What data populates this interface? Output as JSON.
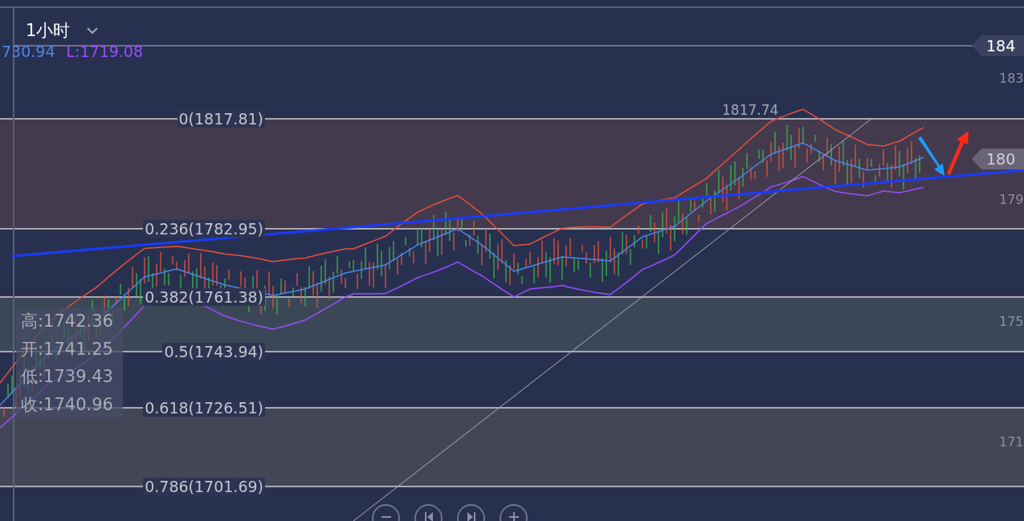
{
  "timeframe": {
    "label": "1小时",
    "expanded": false
  },
  "legend": [
    {
      "text": "730.94",
      "color": "#4a86e8"
    },
    {
      "text": "L:1719.08",
      "color": "#9b4dff"
    }
  ],
  "price_axis": [
    {
      "text": "184",
      "kind": "tag"
    },
    {
      "text": "183",
      "kind": "plain"
    },
    {
      "text": "180",
      "kind": "tag"
    },
    {
      "text": "179",
      "kind": "plain"
    },
    {
      "text": "175",
      "kind": "plain"
    },
    {
      "text": "171",
      "kind": "plain"
    }
  ],
  "fib_levels": [
    {
      "label": "0(1817.81)",
      "color": "#433a4e"
    },
    {
      "label": "0.236(1782.95)"
    },
    {
      "label": "0.382(1761.38)",
      "color": "#3b4756"
    },
    {
      "label": "0.5(1743.94)"
    },
    {
      "label": "0.618(1726.51)",
      "color": "#444658"
    },
    {
      "label": "0.786(1701.69)"
    }
  ],
  "peak_label": "1817.74",
  "ohlc": [
    "高:1742.36",
    "开:1741.25",
    "低:1739.43",
    "收:1740.96"
  ],
  "nav_buttons": [
    {
      "kind": "zoom-out"
    },
    {
      "kind": "previous"
    },
    {
      "kind": "next"
    },
    {
      "kind": "zoom-in"
    }
  ]
}
